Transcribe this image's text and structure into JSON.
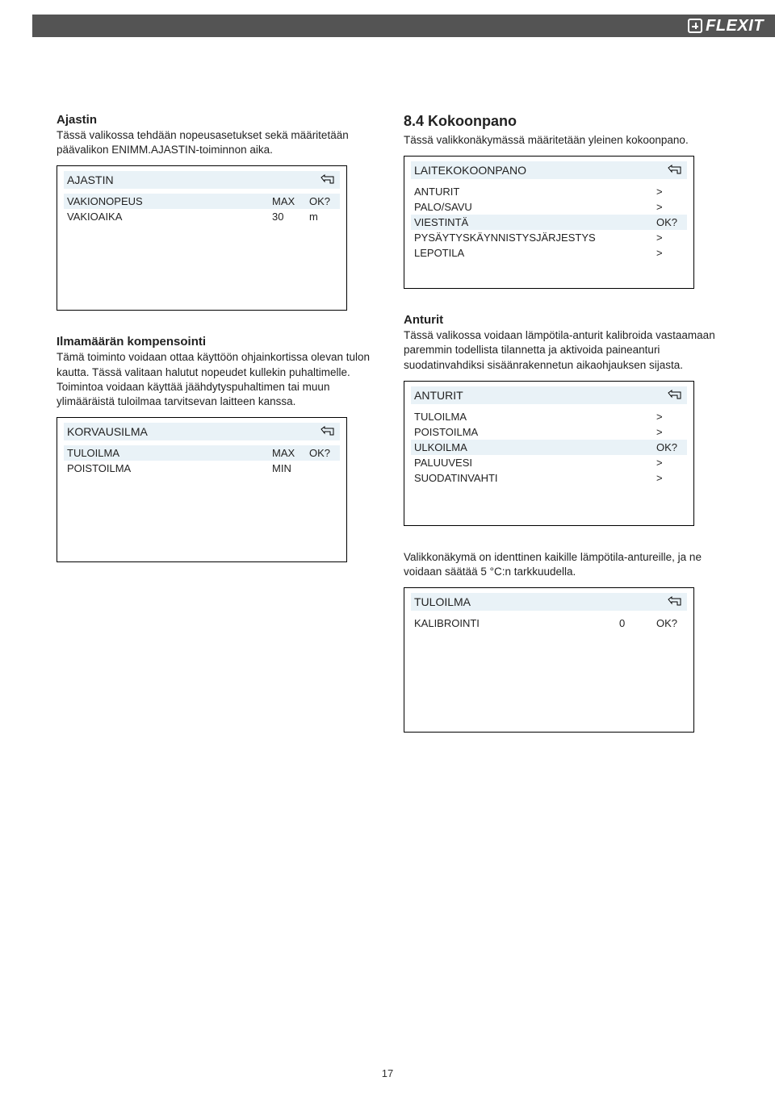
{
  "brand": "FLEXIT",
  "page_number": "17",
  "left": {
    "ajastin": {
      "heading": "Ajastin",
      "desc": "Tässä valikossa tehdään nopeusasetukset sekä määritetään päävalikon ENIMM.AJASTIN-toiminnon aika.",
      "menu_title": "AJASTIN",
      "rows": [
        {
          "label": "VAKIONOPEUS",
          "c1": "MAX",
          "c2": "OK?",
          "hl": true
        },
        {
          "label": "VAKIOAIKA",
          "c1": "30",
          "c2": "m",
          "hl": false
        }
      ]
    },
    "ilma": {
      "heading": "Ilmamäärän kompensointi",
      "desc": "Tämä toiminto voidaan ottaa käyttöön ohjainkortissa olevan tulon kautta. Tässä valitaan halutut nopeudet kullekin puhaltimelle. Toimintoa voidaan käyttää jäähdytyspuhaltimen tai muun ylimääräistä tuloilmaa tarvitsevan laitteen kanssa.",
      "menu_title": "KORVAUSILMA",
      "rows": [
        {
          "label": "TULOILMA",
          "c1": "MAX",
          "c2": "OK?",
          "hl": true
        },
        {
          "label": "POISTOILMA",
          "c1": "MIN",
          "c2": "",
          "hl": false
        }
      ]
    }
  },
  "right": {
    "kokoonpano": {
      "heading": "8.4   Kokoonpano",
      "desc": "Tässä valikkonäkymässä määritetään yleinen kokoonpano.",
      "menu_title": "LAITEKOKOONPANO",
      "rows": [
        {
          "label": "ANTURIT",
          "c1": "",
          "c2": ">",
          "hl": false
        },
        {
          "label": "PALO/SAVU",
          "c1": "",
          "c2": ">",
          "hl": false
        },
        {
          "label": "VIESTINTÄ",
          "c1": "",
          "c2": "OK?",
          "hl": true
        },
        {
          "label": "PYSÄYTYSKÄYNNISTYSJÄRJESTYS",
          "c1": "",
          "c2": ">",
          "hl": false
        },
        {
          "label": "LEPOTILA",
          "c1": "",
          "c2": ">",
          "hl": false
        }
      ]
    },
    "anturit": {
      "heading": "Anturit",
      "desc": "Tässä valikossa voidaan lämpötila-anturit kalibroida vastaamaan paremmin todellista tilannetta ja aktivoida paineanturi suodatinvahdiksi sisäänrakennetun aikaohjauksen sijasta.",
      "menu_title": "ANTURIT",
      "rows": [
        {
          "label": "TULOILMA",
          "c1": "",
          "c2": ">",
          "hl": false
        },
        {
          "label": "POISTOILMA",
          "c1": "",
          "c2": ">",
          "hl": false
        },
        {
          "label": "ULKOILMA",
          "c1": "",
          "c2": "OK?",
          "hl": true
        },
        {
          "label": "PALUUVESI",
          "c1": "",
          "c2": ">",
          "hl": false
        },
        {
          "label": "SUODATINVAHTI",
          "c1": "",
          "c2": ">",
          "hl": false
        }
      ]
    },
    "tuloilma": {
      "desc": "Valikkonäkymä on identtinen kaikille lämpötila-antureille, ja ne voidaan säätää 5 °C:n tarkkuudella.",
      "menu_title": "TULOILMA",
      "rows": [
        {
          "label": "KALIBROINTI",
          "c1": "0",
          "c2": "OK?",
          "hl": false
        }
      ]
    }
  }
}
